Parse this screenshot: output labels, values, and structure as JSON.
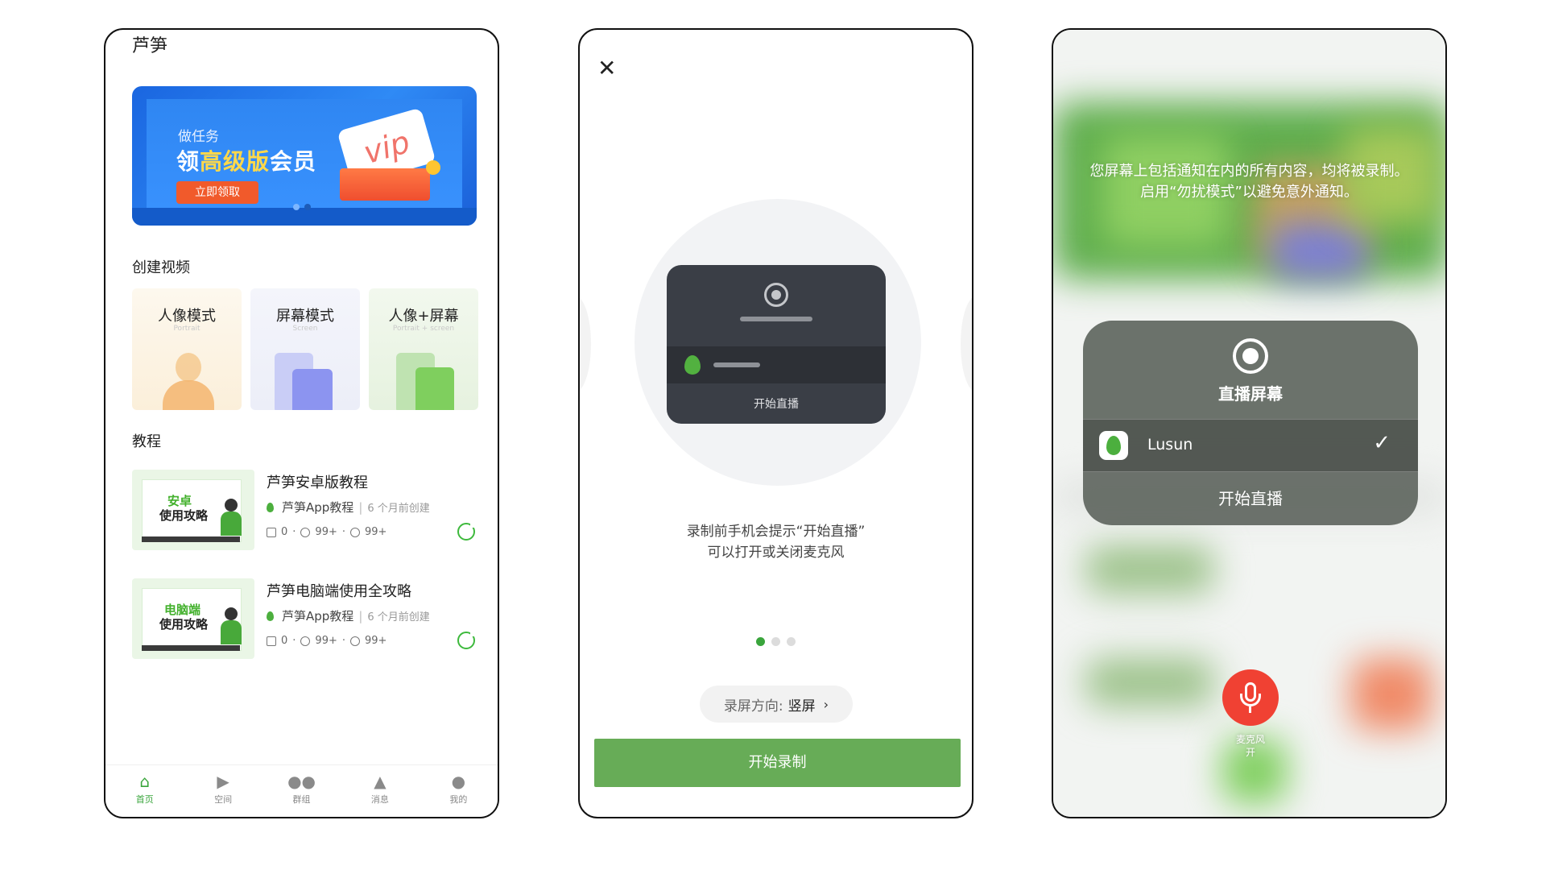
{
  "phone1": {
    "app_title": "芦笋",
    "banner": {
      "sub": "做任务",
      "title_prefix": "领",
      "title_accent": "高级版",
      "title_suffix": "会员",
      "button": "立即领取",
      "vip": "vip"
    },
    "create_section": "创建视频",
    "modes": [
      {
        "title": "人像模式",
        "subtitle": "Portrait"
      },
      {
        "title": "屏幕模式",
        "subtitle": "Screen"
      },
      {
        "title": "人像+屏幕",
        "subtitle": "Portrait + screen"
      }
    ],
    "tutorial_section": "教程",
    "tutorials": [
      {
        "thumb_line1": "安卓",
        "thumb_line2": "使用攻略",
        "title": "芦笋安卓版教程",
        "channel": "芦笋App教程",
        "sep": "|",
        "ago": "6 个月前创建",
        "comments": "0",
        "likes": "99+",
        "views": "99+"
      },
      {
        "thumb_line1": "电脑端",
        "thumb_line2": "使用攻略",
        "title": "芦笋电脑端使用全攻略",
        "channel": "芦笋App教程",
        "sep": "|",
        "ago": "6 个月前创建",
        "comments": "0",
        "likes": "99+",
        "views": "99+"
      }
    ],
    "tabs": [
      {
        "label": "首页",
        "icon": "home-icon",
        "active": true
      },
      {
        "label": "空间",
        "icon": "play-icon",
        "active": false
      },
      {
        "label": "群组",
        "icon": "group-icon",
        "active": false
      },
      {
        "label": "消息",
        "icon": "bell-icon",
        "active": false
      },
      {
        "label": "我的",
        "icon": "user-icon",
        "active": false
      }
    ]
  },
  "phone2": {
    "close_icon": "close-icon",
    "mock_label": "开始直播",
    "hint_line1": "录制前手机会提示“开始直播”",
    "hint_line2": "可以打开或关闭麦克风",
    "pager": {
      "count": 3,
      "active": 0
    },
    "orientation_label": "录屏方向:",
    "orientation_value": "竖屏",
    "start_button": "开始录制"
  },
  "phone3": {
    "notice": "您屏幕上包括通知在内的所有内容，均将被录制。启用“勿扰模式”以避免意外通知。",
    "sheet_title": "直播屏幕",
    "app_name": "Lusun",
    "start_broadcast": "开始直播",
    "mic_label_1": "麦克风",
    "mic_label_2": "开"
  },
  "colors": {
    "accent_green": "#3aa53c",
    "button_green": "#67ac57",
    "banner_blue": "#2f8af5",
    "mic_red": "#f04133"
  }
}
